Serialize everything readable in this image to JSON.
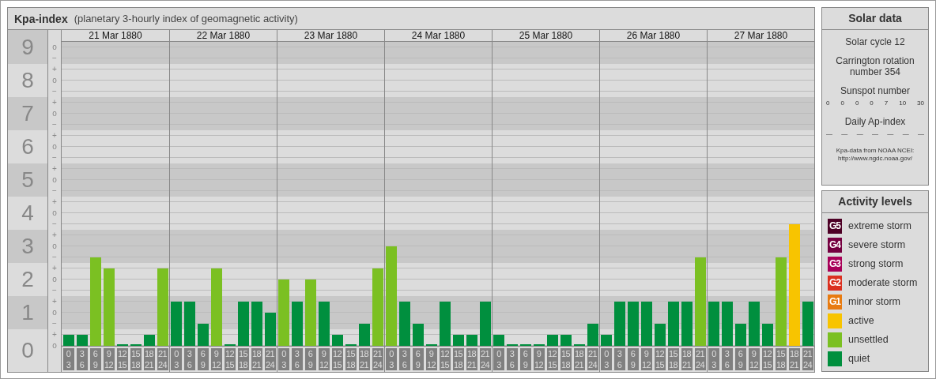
{
  "main": {
    "title": "Kpa-index",
    "subtitle": "(planetary 3-hourly index of geomagnetic activity)",
    "days": [
      "21 Mar 1880",
      "22 Mar 1880",
      "23 Mar 1880",
      "24 Mar 1880",
      "25 Mar 1880",
      "26 Mar 1880",
      "27 Mar 1880"
    ],
    "minor_ticks": [
      "o",
      "−",
      "+",
      "o",
      "−",
      "+",
      "o",
      "−",
      "+",
      "o",
      "−",
      "+",
      "o",
      "−",
      "+",
      "o",
      "−",
      "+",
      "o",
      "−",
      "+",
      "o",
      "−",
      "+",
      "o",
      "−",
      "+",
      "o"
    ],
    "chart_data": {
      "type": "bar",
      "ylim": [
        0,
        9
      ],
      "grid": true,
      "categories": [
        "0 3",
        "3 6",
        "6 9",
        "9 12",
        "12 15",
        "15 18",
        "18 21",
        "21 24",
        "0 3",
        "3 6",
        "6 9",
        "9 12",
        "12 15",
        "15 18",
        "18 21",
        "21 24",
        "0 3",
        "3 6",
        "6 9",
        "9 12",
        "12 15",
        "15 18",
        "18 21",
        "21 24",
        "0 3",
        "3 6",
        "6 9",
        "9 12",
        "12 15",
        "15 18",
        "18 21",
        "21 24",
        "0 3",
        "3 6",
        "6 9",
        "9 12",
        "12 15",
        "15 18",
        "18 21",
        "21 24",
        "0 3",
        "3 6",
        "6 9",
        "9 12",
        "12 15",
        "15 18",
        "18 21",
        "21 24",
        "0 3",
        "3 6",
        "6 9",
        "9 12",
        "12 15",
        "15 18",
        "18 21",
        "21 24"
      ],
      "series": [
        {
          "values": [
            0.33,
            0.33,
            2.67,
            2.33,
            0,
            0,
            0.33,
            2.33,
            1.33,
            1.33,
            0.67,
            2.33,
            0,
            1.33,
            1.33,
            1,
            2,
            1.33,
            2,
            1.33,
            0.33,
            0,
            0.67,
            2.33,
            3,
            1.33,
            0.67,
            0,
            1.33,
            0.33,
            0.33,
            1.33,
            0.33,
            0,
            0,
            0,
            0.33,
            0.33,
            0,
            0.67,
            0.33,
            1.33,
            1.33,
            1.33,
            0.67,
            1.33,
            1.33,
            2.67,
            1.33,
            1.33,
            0.67,
            1.33,
            0.67,
            2.67,
            3.67,
            1.33
          ]
        }
      ],
      "yticks": [
        9,
        8,
        7,
        6,
        5,
        4,
        3,
        2,
        1,
        0
      ]
    }
  },
  "solar": {
    "title": "Solar data",
    "lines": [
      "Solar cycle 12",
      "Carrington rotation number 354"
    ],
    "sunspot": {
      "label": "Sunspot number",
      "values": [
        "0",
        "0",
        "0",
        "0",
        "7",
        "10",
        "30"
      ]
    },
    "ap": {
      "label": "Daily Ap-index",
      "values": [
        "—",
        "—",
        "—",
        "—",
        "—",
        "—",
        "—"
      ]
    },
    "source": [
      "Kpa-data from NOAA NCEI:",
      "http://www.ngdc.noaa.gov/"
    ]
  },
  "legend": {
    "title": "Activity levels",
    "items": [
      {
        "badge": "G5",
        "label": "extreme storm",
        "color": "#4d0025"
      },
      {
        "badge": "G4",
        "label": "severe storm",
        "color": "#750040"
      },
      {
        "badge": "G3",
        "label": "strong storm",
        "color": "#a80058"
      },
      {
        "badge": "G2",
        "label": "moderate storm",
        "color": "#db3020"
      },
      {
        "badge": "G1",
        "label": "minor storm",
        "color": "#e87b10"
      },
      {
        "label": "active",
        "color": "#f8c400"
      },
      {
        "label": "unsettled",
        "color": "#7bc022"
      },
      {
        "label": "quiet",
        "color": "#008f3e"
      }
    ]
  }
}
